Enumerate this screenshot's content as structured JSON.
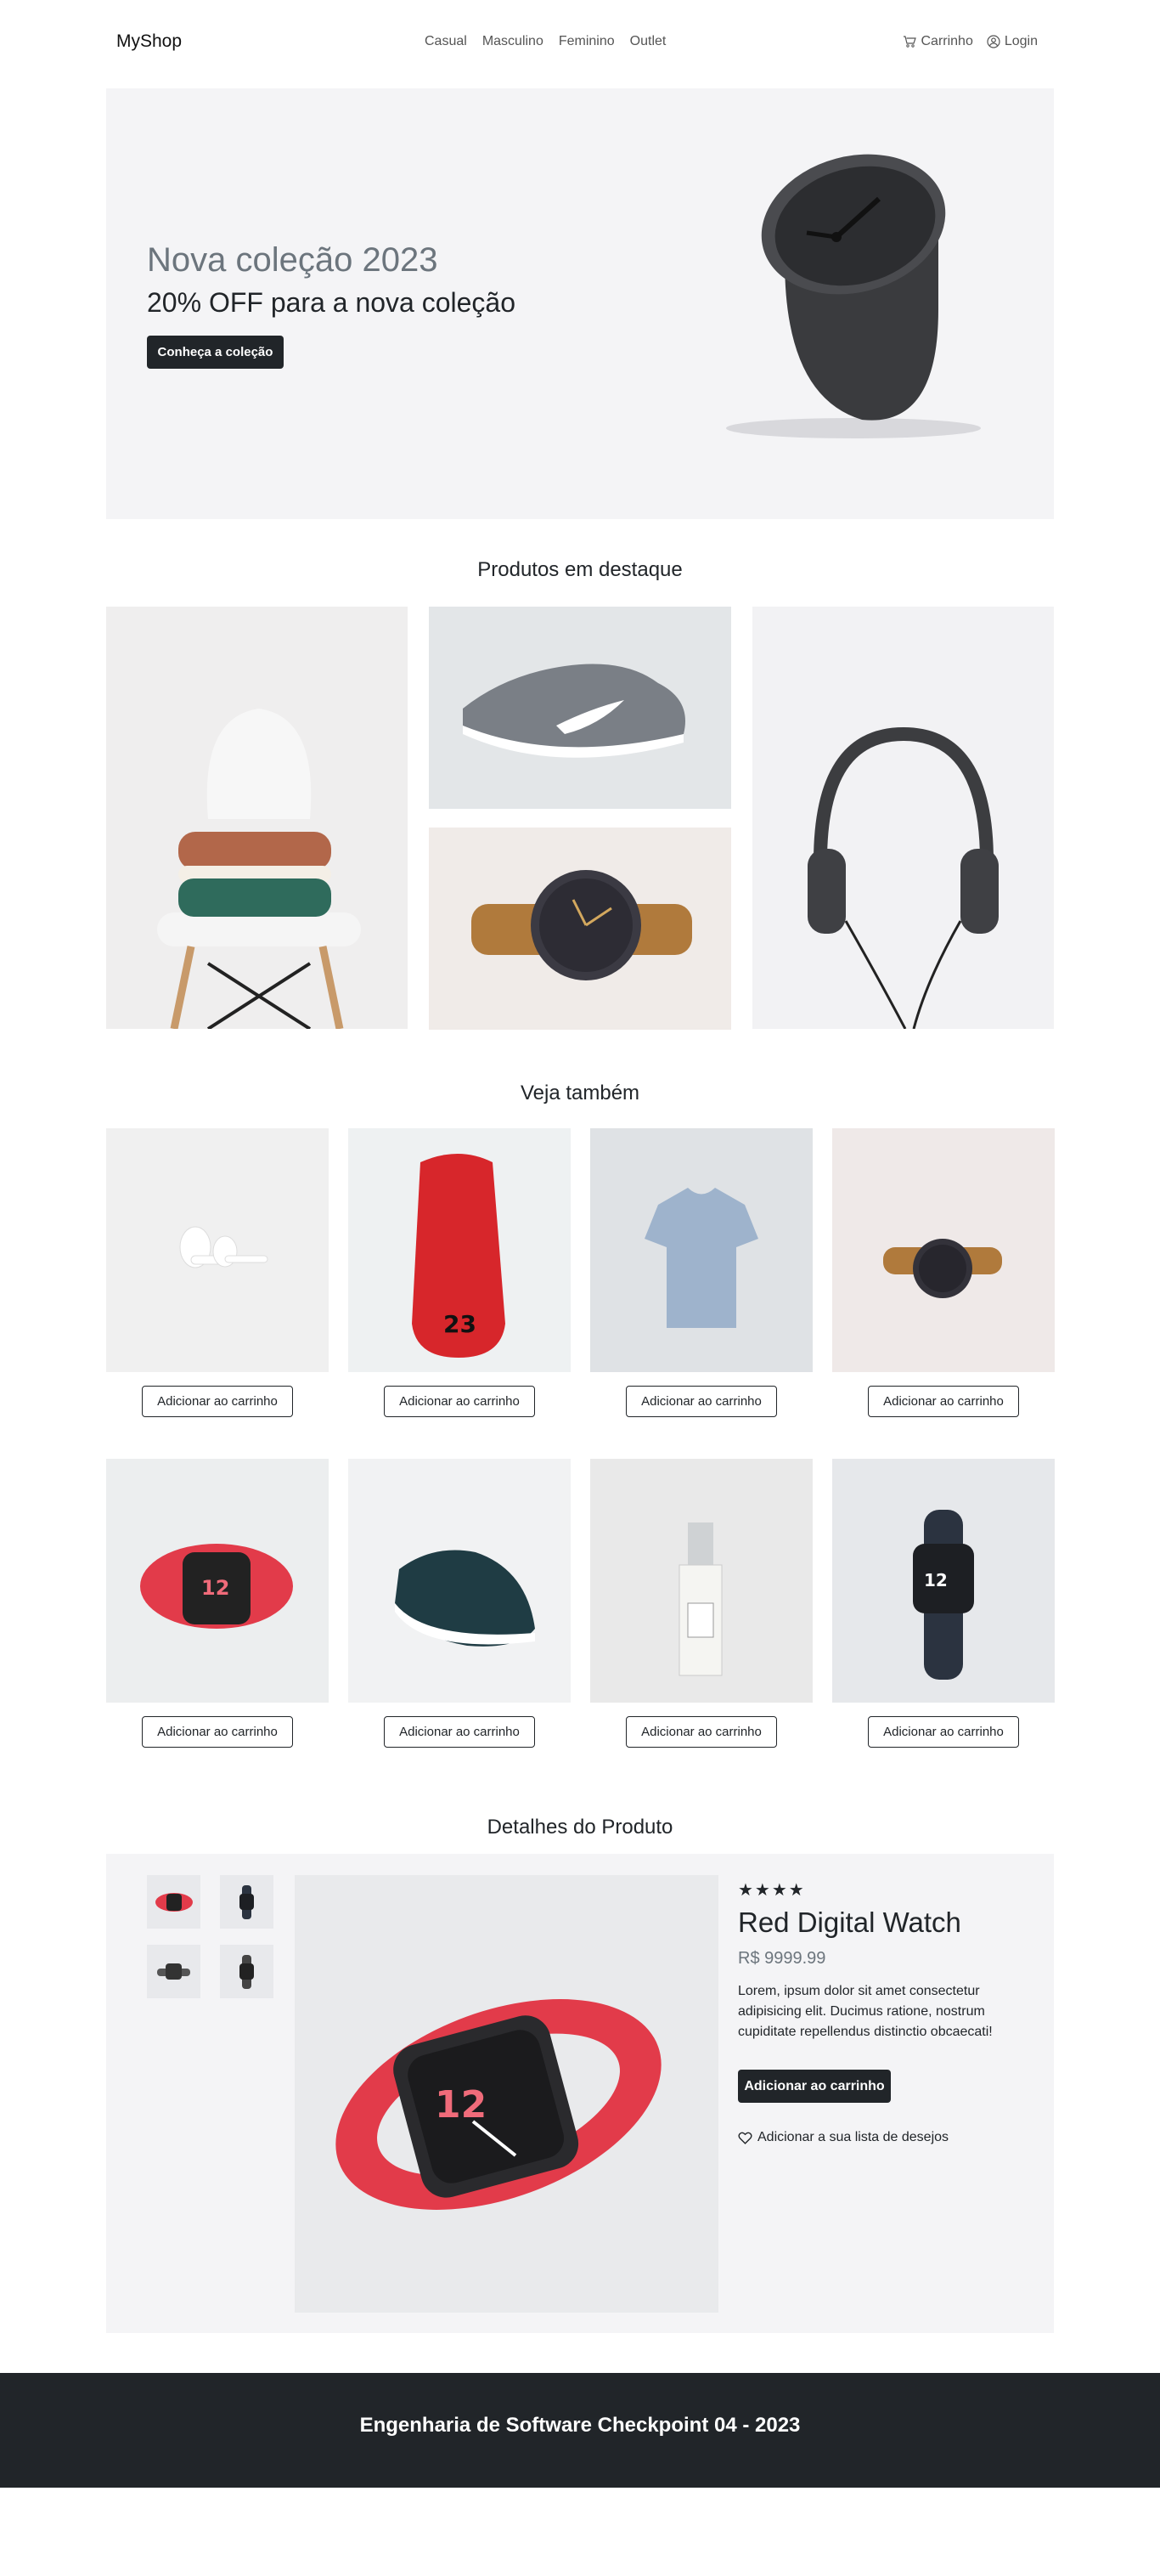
{
  "nav": {
    "brand": "MyShop",
    "links": [
      "Casual",
      "Masculino",
      "Feminino",
      "Outlet"
    ],
    "cart_label": "Carrinho",
    "login_label": "Login"
  },
  "hero": {
    "title": "Nova coleção 2023",
    "subtitle": "20% OFF para a nova coleção",
    "button_label": "Conheça a coleção",
    "image_icon": "table-clock-image"
  },
  "featured": {
    "title": "Produtos em destaque",
    "items": [
      "sweaters-on-chair-image",
      "sneaker-image",
      "wristwatch-image",
      "headphones-image"
    ]
  },
  "see_also": {
    "title": "Veja também",
    "products": [
      {
        "image": "earbuds-image",
        "button_label": "Adicionar ao carrinho"
      },
      {
        "image": "red-sneaker-image",
        "button_label": "Adicionar ao carrinho"
      },
      {
        "image": "tshirt-image",
        "button_label": "Adicionar ao carrinho"
      },
      {
        "image": "wristwatch-image",
        "button_label": "Adicionar ao carrinho"
      },
      {
        "image": "red-smartwatch-image",
        "button_label": "Adicionar ao carrinho"
      },
      {
        "image": "teal-sneaker-image",
        "button_label": "Adicionar ao carrinho"
      },
      {
        "image": "perfume-image",
        "button_label": "Adicionar ao carrinho"
      },
      {
        "image": "black-smartwatch-image",
        "button_label": "Adicionar ao carrinho"
      }
    ]
  },
  "details": {
    "title": "Detalhes do Produto",
    "rating": "★★★★",
    "rating_value": 4,
    "name": "Red Digital Watch",
    "price": "R$ 9999.99",
    "description": "Lorem, ipsum dolor sit amet consectetur adipisicing elit. Ducimus ratione, nostrum cupiditate repellendus distinctio obcaecati!",
    "add_button_label": "Adicionar ao carrinho",
    "wishlist_label": "Adicionar a sua lista de desejos"
  },
  "footer": {
    "text": "Engenharia de Software Checkpoint 04 - 2023"
  },
  "colors": {
    "dark": "#212529",
    "muted": "#6c757d",
    "panel": "#f4f4f6",
    "accent_red": "#e23b4a"
  }
}
